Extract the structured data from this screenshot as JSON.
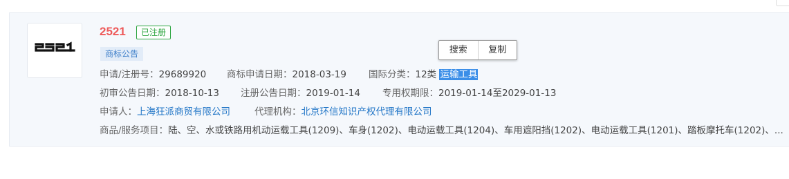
{
  "trademark": {
    "number": "2521",
    "status_badge": "已注册",
    "notice_tag": "商标公告",
    "logo_alt": "2521 logo"
  },
  "row1": {
    "reg_label": "申请/注册号：",
    "reg_value": "29689920",
    "apply_date_label": "商标申请日期：",
    "apply_date_value": "2018-03-19",
    "intl_class_label": "国际分类：",
    "intl_class_value": "12类",
    "intl_class_name": "运输工具"
  },
  "row2": {
    "prelim_label": "初审公告日期：",
    "prelim_value": "2018-10-13",
    "reg_notice_label": "注册公告日期：",
    "reg_notice_value": "2019-01-14",
    "exclusive_label": "专用权期限：",
    "exclusive_value": "2019-01-14至2029-01-13"
  },
  "row3": {
    "applicant_label": "申请人：",
    "applicant_value": "上海狂派商贸有限公司",
    "agency_label": "代理机构：",
    "agency_value": "北京环信知识产权代理有限公司"
  },
  "row4": {
    "goods_label": "商品/服务项目：",
    "goods_value": "陆、空、水或铁路用机动运载工具(1209)、车身(1202)、电动运载工具(1204)、车用遮阳挡(1202)、电动运载工具(1201)、踏板摩托车(1202)、..."
  },
  "popup": {
    "search_label": "搜索",
    "copy_label": "复制"
  }
}
